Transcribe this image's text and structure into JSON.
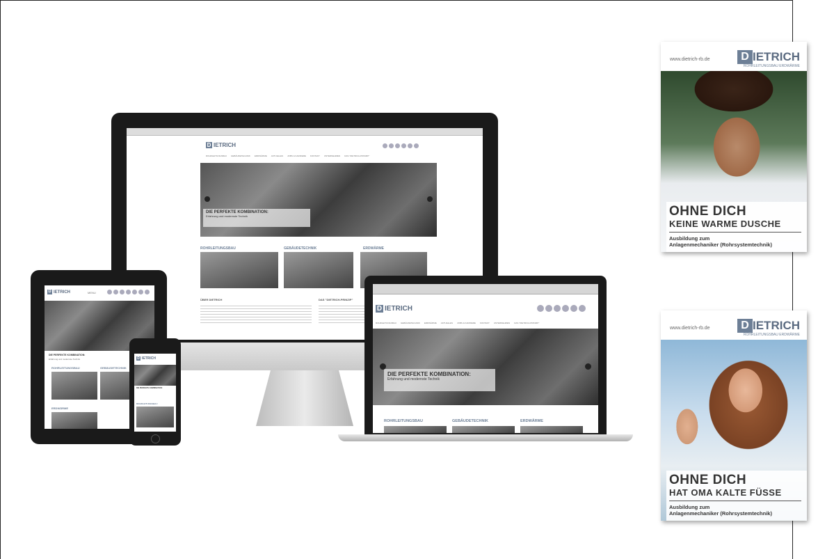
{
  "brand": {
    "logo_mark": "D",
    "logo_text": "IETRICH",
    "logo_full": "DIETRICH",
    "tagline": "ROHRLEITUNGSBAU ERDWÄRME"
  },
  "site": {
    "url": "www.dietrich-rb.de",
    "nav": [
      "ROHRLEITUNGSBAU",
      "GEBÄUDETECHNIK",
      "ERDWÄRME",
      "AKTUELLES",
      "JOBS & KARRIERE",
      "KONTAKT",
      "UNTERNEHMEN",
      "DAS \"DIETRICH-PRINZIP\""
    ],
    "hero_title": "DIE PERFEKTE KOMBINATION:",
    "hero_subtitle": "Erfahrung und modernste Technik",
    "categories": [
      "ROHRLEITUNGSBAU",
      "GEBÄUDETECHNIK",
      "ERDWÄRME"
    ],
    "about_heading": "ÜBER DIETRICH",
    "principle_heading": "DAS \"DIETRICH-PRINZIP\"",
    "menu_label": "MENU"
  },
  "posters": [
    {
      "url": "www.dietrich-rb.de",
      "headline": "OHNE DICH",
      "subline": "KEINE WARME DUSCHE",
      "text1": "Ausbildung zum",
      "text2": "Anlagenmechaniker (Rohrsystemtechnik)"
    },
    {
      "url": "www.dietrich-rb.de",
      "headline": "OHNE DICH",
      "subline": "HAT OMA KALTE FÜSSE",
      "text1": "Ausbildung zum",
      "text2": "Anlagenmechaniker (Rohrsystemtechnik)"
    }
  ],
  "colors": {
    "brand": "#6d7f96",
    "text_dark": "#333333",
    "device_black": "#1a1a1a"
  }
}
